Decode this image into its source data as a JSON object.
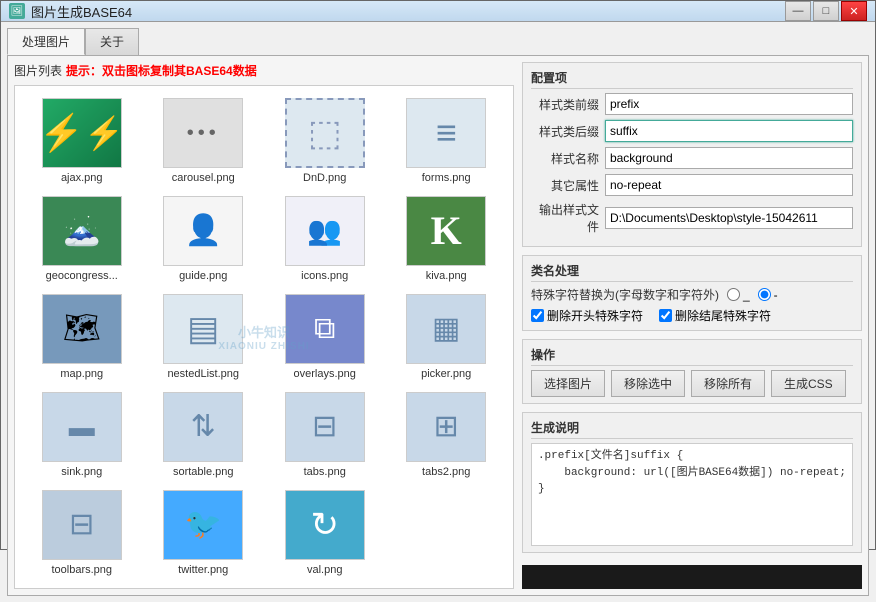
{
  "window": {
    "title": "图片生成BASE64",
    "icon": "🖼"
  },
  "titleButtons": {
    "minimize": "—",
    "maximize": "□",
    "close": "✕"
  },
  "tabs": [
    {
      "label": "处理图片",
      "active": true
    },
    {
      "label": "关于",
      "active": false
    }
  ],
  "imageList": {
    "listLabel": "图片列表",
    "hint": "提示：双击图标复制其BASE64数据"
  },
  "images": [
    {
      "name": "ajax.png",
      "iconClass": "icon-ajax",
      "symbol": "⚡"
    },
    {
      "name": "carousel.png",
      "iconClass": "icon-carousel",
      "symbol": "•••"
    },
    {
      "name": "DnD.png",
      "iconClass": "icon-dnd",
      "symbol": "⬚"
    },
    {
      "name": "forms.png",
      "iconClass": "icon-forms",
      "symbol": "≡"
    },
    {
      "name": "geocongress...",
      "iconClass": "icon-geocongress",
      "symbol": "🗻"
    },
    {
      "name": "guide.png",
      "iconClass": "icon-guide",
      "symbol": "👤"
    },
    {
      "name": "icons.png",
      "iconClass": "icon-icons",
      "symbol": "👥"
    },
    {
      "name": "kiva.png",
      "iconClass": "icon-kiva",
      "symbol": "K"
    },
    {
      "name": "map.png",
      "iconClass": "icon-map",
      "symbol": "🗺"
    },
    {
      "name": "nestedList.png",
      "iconClass": "icon-nestedlist",
      "symbol": "▤"
    },
    {
      "name": "overlays.png",
      "iconClass": "icon-overlays",
      "symbol": "⧉"
    },
    {
      "name": "picker.png",
      "iconClass": "icon-picker",
      "symbol": "📅"
    },
    {
      "name": "sink.png",
      "iconClass": "icon-sink",
      "symbol": "≡"
    },
    {
      "name": "sortable.png",
      "iconClass": "icon-sortable",
      "symbol": "⇅"
    },
    {
      "name": "tabs.png",
      "iconClass": "icon-tabs",
      "symbol": "⊟"
    },
    {
      "name": "tabs2.png",
      "iconClass": "icon-tabs2",
      "symbol": "⊞"
    },
    {
      "name": "toolbars.png",
      "iconClass": "icon-toolbars",
      "symbol": "⊟"
    },
    {
      "name": "twitter.png",
      "iconClass": "icon-twitter",
      "symbol": "🐦"
    },
    {
      "name": "val.png",
      "iconClass": "icon-val",
      "symbol": "↻"
    }
  ],
  "config": {
    "sectionTitle": "配置项",
    "prefixLabel": "样式类前缀",
    "prefixValue": "prefix",
    "suffixLabel": "样式类后缀",
    "suffixValue": "suffix",
    "nameLabel": "样式名称",
    "nameValue": "background",
    "otherLabel": "其它属性",
    "otherValue": "no-repeat",
    "outputLabel": "输出样式文件",
    "outputValue": "D:\\Documents\\Desktop\\style-15042611"
  },
  "classSection": {
    "sectionTitle": "类名处理",
    "radioLabel": "特殊字符替换为(字母数字和字符外)",
    "radio1Value": "_",
    "radio2Value": "-",
    "radio2Checked": true,
    "checkbox1Label": "删除开头特殊字符",
    "checkbox1Checked": true,
    "checkbox2Label": "删除结尾特殊字符",
    "checkbox2Checked": true
  },
  "operations": {
    "sectionTitle": "操作",
    "btn1": "选择图片",
    "btn2": "移除选中",
    "btn3": "移除所有",
    "btn4": "生成CSS"
  },
  "descSection": {
    "sectionTitle": "生成说明",
    "codeContent": ".prefix[文件名]suffix {\n    background: url([图片BASE64数据]) no-repeat;\n}"
  },
  "watermark": {
    "line1": "小牛知识",
    "line2": "XIAONIU ZHISHI"
  }
}
